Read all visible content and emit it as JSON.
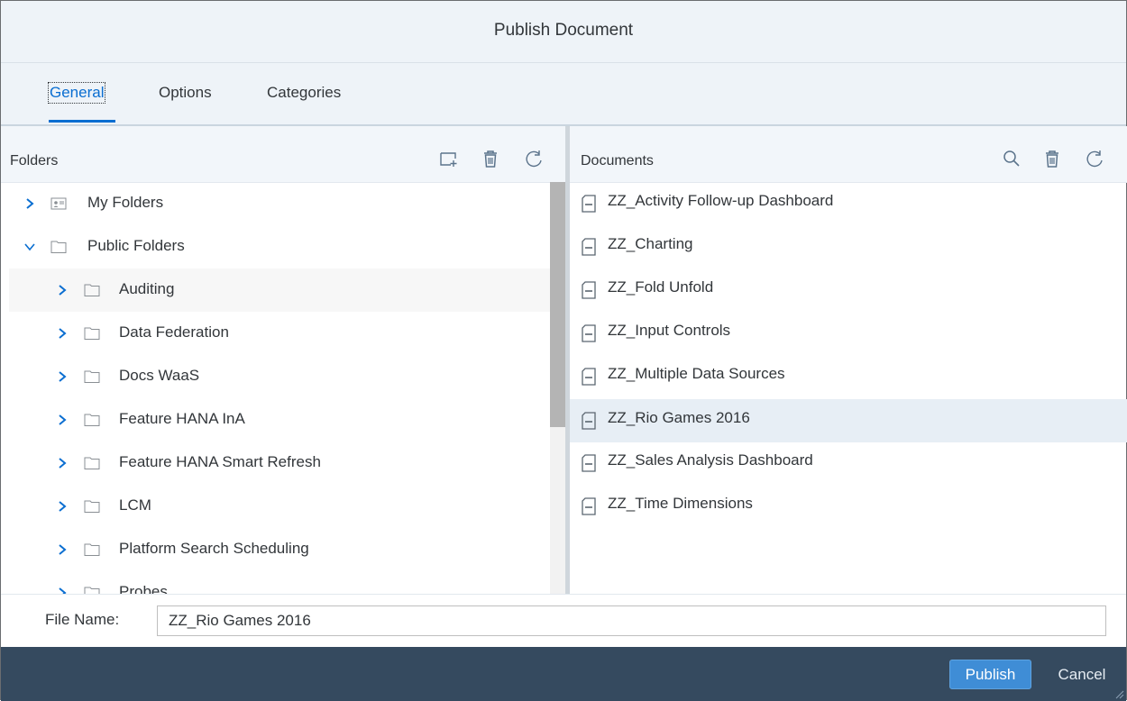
{
  "dialog": {
    "title": "Publish Document"
  },
  "tabs": [
    {
      "label": "General",
      "active": true
    },
    {
      "label": "Options",
      "active": false
    },
    {
      "label": "Categories",
      "active": false
    }
  ],
  "folders_panel": {
    "label": "Folders",
    "icons": [
      "new-folder-icon",
      "delete-icon",
      "refresh-icon"
    ],
    "tree": [
      {
        "label": "My Folders",
        "icon": "user-folder-icon",
        "expanded": false,
        "level": 0
      },
      {
        "label": "Public Folders",
        "icon": "folder-icon",
        "expanded": true,
        "level": 0
      },
      {
        "label": "Auditing",
        "icon": "folder-icon",
        "expanded": false,
        "level": 1
      },
      {
        "label": "Data Federation",
        "icon": "folder-icon",
        "expanded": false,
        "level": 1
      },
      {
        "label": "Docs WaaS",
        "icon": "folder-icon",
        "expanded": false,
        "level": 1
      },
      {
        "label": "Feature HANA InA",
        "icon": "folder-icon",
        "expanded": false,
        "level": 1
      },
      {
        "label": "Feature HANA Smart Refresh",
        "icon": "folder-icon",
        "expanded": false,
        "level": 1
      },
      {
        "label": "LCM",
        "icon": "folder-icon",
        "expanded": false,
        "level": 1
      },
      {
        "label": "Platform Search Scheduling",
        "icon": "folder-icon",
        "expanded": false,
        "level": 1
      },
      {
        "label": "Probes",
        "icon": "folder-icon",
        "expanded": false,
        "level": 1
      }
    ]
  },
  "documents_panel": {
    "label": "Documents",
    "icons": [
      "search-icon",
      "delete-icon",
      "refresh-icon"
    ],
    "items": [
      {
        "label": "ZZ_Activity Follow-up Dashboard"
      },
      {
        "label": "ZZ_Charting"
      },
      {
        "label": "ZZ_Fold Unfold"
      },
      {
        "label": "ZZ_Input Controls"
      },
      {
        "label": "ZZ_Multiple Data Sources"
      },
      {
        "label": "ZZ_Rio Games 2016",
        "selected": true
      },
      {
        "label": "ZZ_Sales Analysis Dashboard"
      },
      {
        "label": "ZZ_Time Dimensions"
      }
    ]
  },
  "file_name": {
    "label": "File Name:",
    "value": "ZZ_Rio Games 2016"
  },
  "footer": {
    "publish_label": "Publish",
    "cancel_label": "Cancel"
  },
  "colors": {
    "accent": "#0a6ed1",
    "footer_bg": "#354a5f",
    "header_bg": "#eef3f8",
    "selected_doc_bg": "#e7eef5"
  }
}
